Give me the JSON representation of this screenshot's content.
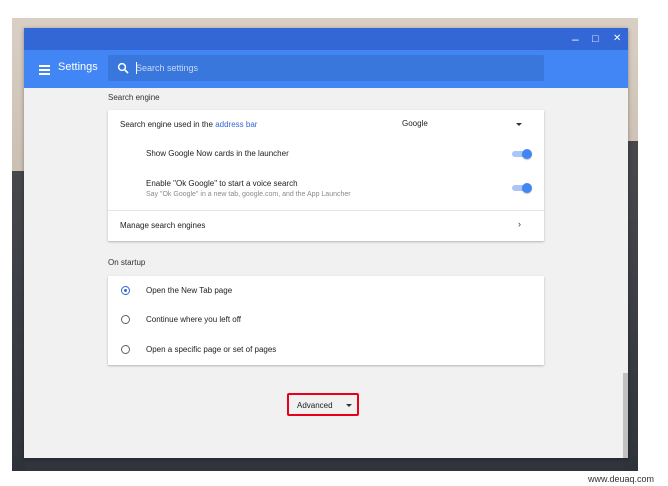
{
  "window": {
    "controls": {
      "minimize": "–",
      "maximize": "□",
      "close": "✕"
    }
  },
  "appbar": {
    "menu_icon": "hamburger-menu-icon",
    "title": "Settings",
    "search": {
      "icon": "search-icon",
      "placeholder": "Search settings",
      "value": ""
    }
  },
  "search_engine": {
    "section_title": "Search engine",
    "used_label_prefix": "Search engine used in the ",
    "used_label_link": "address bar",
    "selected_engine": "Google",
    "google_now_label": "Show Google Now cards in the launcher",
    "google_now_enabled": true,
    "ok_google_label": "Enable \"Ok Google\" to start a voice search",
    "ok_google_sub": "Say \"Ok Google\" in a new tab, google.com, and the App Launcher",
    "ok_google_enabled": true,
    "manage_label": "Manage search engines",
    "manage_chevron": "›"
  },
  "on_startup": {
    "section_title": "On startup",
    "options": [
      {
        "label": "Open the New Tab page",
        "selected": true
      },
      {
        "label": "Continue where you left off",
        "selected": false
      },
      {
        "label": "Open a specific page or set of pages",
        "selected": false
      }
    ]
  },
  "advanced": {
    "label": "Advanced"
  },
  "watermark": "www.deuaq.com",
  "colors": {
    "titlebar": "#3367d6",
    "appbar": "#4285f4",
    "highlight": "#e8001a"
  }
}
